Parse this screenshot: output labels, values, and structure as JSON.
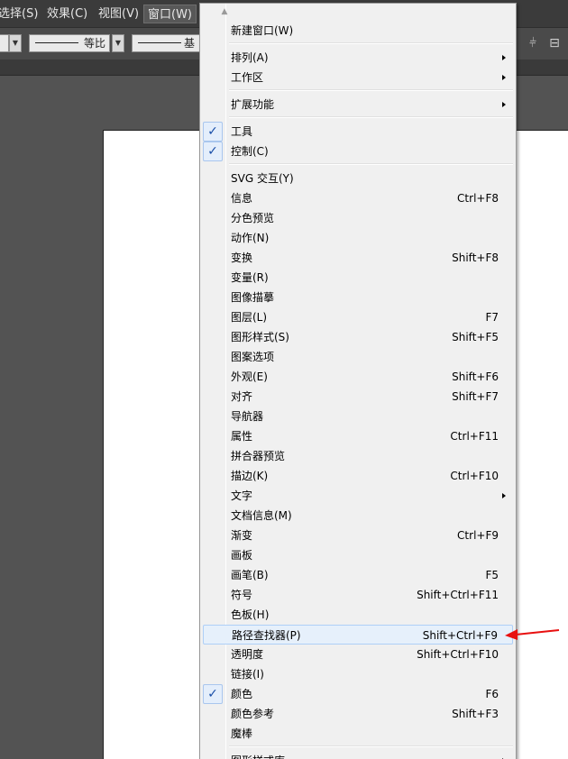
{
  "menubar": {
    "items": [
      {
        "label": "选择(S)"
      },
      {
        "label": "效果(C)"
      },
      {
        "label": "视图(V)"
      },
      {
        "label": "窗口(W)",
        "active": true
      }
    ]
  },
  "controlbar": {
    "profile_label": "等比",
    "brush_label": "基本"
  },
  "window_menu": {
    "items": [
      {
        "label": "新建窗口(W)"
      },
      {
        "type": "separator"
      },
      {
        "label": "排列(A)",
        "submenu": true
      },
      {
        "label": "工作区",
        "submenu": true
      },
      {
        "type": "separator"
      },
      {
        "label": "扩展功能",
        "submenu": true
      },
      {
        "type": "separator"
      },
      {
        "label": "工具",
        "checked": true
      },
      {
        "label": "控制(C)",
        "checked": true
      },
      {
        "type": "separator"
      },
      {
        "label": "SVG 交互(Y)"
      },
      {
        "label": "信息",
        "shortcut": "Ctrl+F8"
      },
      {
        "label": "分色预览"
      },
      {
        "label": "动作(N)"
      },
      {
        "label": "变换",
        "shortcut": "Shift+F8"
      },
      {
        "label": "变量(R)"
      },
      {
        "label": "图像描摹"
      },
      {
        "label": "图层(L)",
        "shortcut": "F7"
      },
      {
        "label": "图形样式(S)",
        "shortcut": "Shift+F5"
      },
      {
        "label": "图案选项"
      },
      {
        "label": "外观(E)",
        "shortcut": "Shift+F6"
      },
      {
        "label": "对齐",
        "shortcut": "Shift+F7"
      },
      {
        "label": "导航器"
      },
      {
        "label": "属性",
        "shortcut": "Ctrl+F11"
      },
      {
        "label": "拼合器预览"
      },
      {
        "label": "描边(K)",
        "shortcut": "Ctrl+F10"
      },
      {
        "label": "文字",
        "submenu": true
      },
      {
        "label": "文档信息(M)"
      },
      {
        "label": "渐变",
        "shortcut": "Ctrl+F9"
      },
      {
        "label": "画板"
      },
      {
        "label": "画笔(B)",
        "shortcut": "F5"
      },
      {
        "label": "符号",
        "shortcut": "Shift+Ctrl+F11"
      },
      {
        "label": "色板(H)"
      },
      {
        "label": "路径查找器(P)",
        "shortcut": "Shift+Ctrl+F9",
        "highlighted": true
      },
      {
        "label": "透明度",
        "shortcut": "Shift+Ctrl+F10"
      },
      {
        "label": "链接(I)"
      },
      {
        "label": "颜色",
        "shortcut": "F6",
        "checked": true
      },
      {
        "label": "颜色参考",
        "shortcut": "Shift+F3"
      },
      {
        "label": "魔棒"
      },
      {
        "type": "separator"
      },
      {
        "label": "图形样式库",
        "submenu": true
      }
    ]
  },
  "colors": {
    "annotation_arrow": "#e81010",
    "highlight_bg": "#e6f0fb",
    "check_mark": "#1a4fa8"
  },
  "icons": {
    "checked": "check-icon",
    "submenu": "chevron-right-icon",
    "scroll": "scroll-up-icon"
  }
}
